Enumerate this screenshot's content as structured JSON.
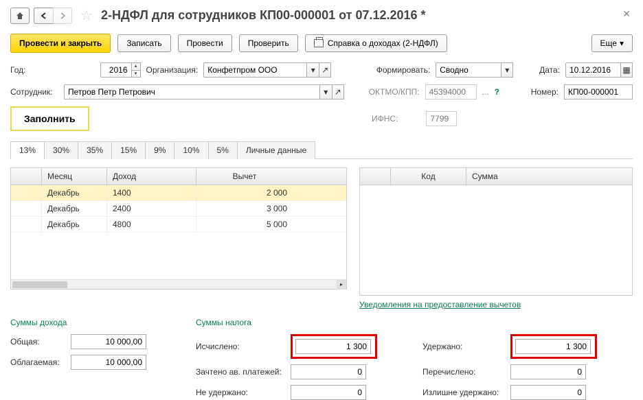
{
  "title": "2-НДФЛ для сотрудников КП00-000001 от 07.12.2016 *",
  "toolbar": {
    "post_close": "Провести и закрыть",
    "save": "Записать",
    "post": "Провести",
    "check": "Проверить",
    "cert": "Справка о доходах (2-НДФЛ)",
    "more": "Еще"
  },
  "fields": {
    "year_label": "Год:",
    "year": "2016",
    "org_label": "Организация:",
    "org": "Конфетпром ООО",
    "form_label": "Формировать:",
    "form": "Сводно",
    "date_label": "Дата:",
    "date": "10.12.2016",
    "emp_label": "Сотрудник:",
    "emp": "Петров Петр Петрович",
    "oktmo_label": "ОКТМО/КПП:",
    "oktmo": "45394000",
    "num_label": "Номер:",
    "num": "КП00-000001",
    "ifns_label": "ИФНС:",
    "ifns": "7799",
    "fill": "Заполнить"
  },
  "tabs": [
    "13%",
    "30%",
    "35%",
    "15%",
    "9%",
    "10%",
    "5%",
    "Личные данные"
  ],
  "gridL": {
    "h_month": "Месяц",
    "h_income": "Доход",
    "h_ded": "Вычет",
    "rows": [
      {
        "m": "Декабрь",
        "i": "1400",
        "d": "2 000"
      },
      {
        "m": "Декабрь",
        "i": "2400",
        "d": "3 000"
      },
      {
        "m": "Декабрь",
        "i": "4800",
        "d": "5 000"
      }
    ]
  },
  "gridR": {
    "h_code": "Код",
    "h_sum": "Сумма"
  },
  "link_ded": "Уведомления на предоставление вычетов",
  "sums": {
    "income_head": "Суммы дохода",
    "total_l": "Общая:",
    "total_v": "10 000,00",
    "taxable_l": "Облагаемая:",
    "taxable_v": "10 000,00",
    "tax_head": "Суммы налога",
    "calc_l": "Исчислено:",
    "calc_v": "1 300",
    "adv_l": "Зачтено ав. платежей:",
    "adv_v": "0",
    "notheld_l": "Не удержано:",
    "notheld_v": "0",
    "held_l": "Удержано:",
    "held_v": "1 300",
    "trans_l": "Перечислено:",
    "trans_v": "0",
    "over_l": "Излишне удержано:",
    "over_v": "0"
  }
}
